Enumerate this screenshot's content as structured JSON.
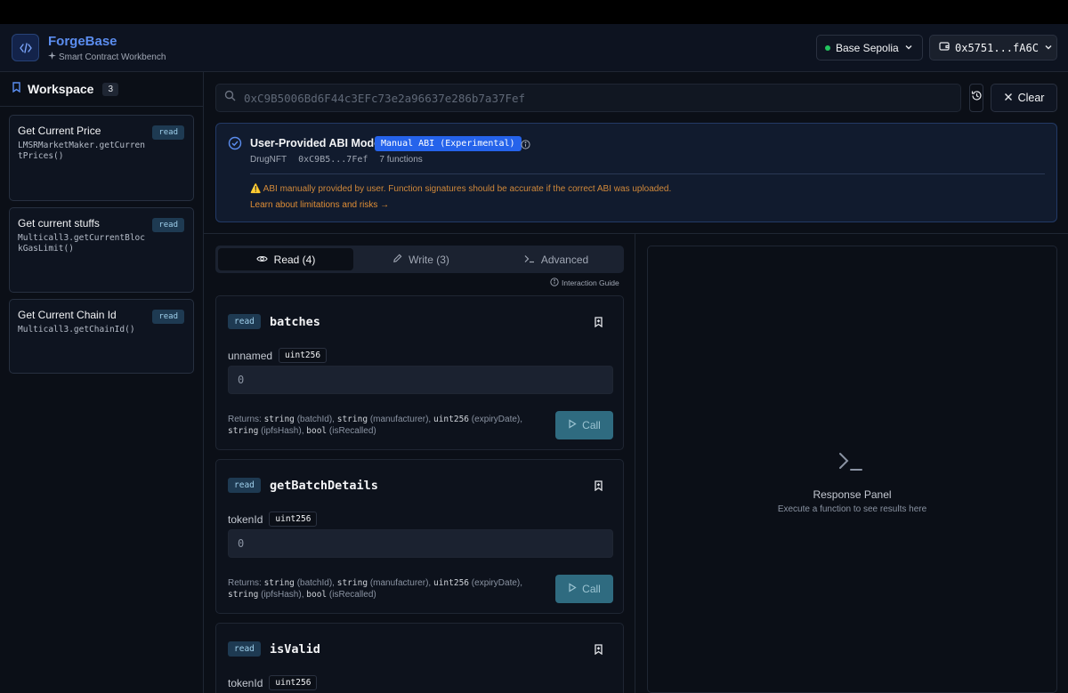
{
  "app": {
    "name": "ForgeBase",
    "subtitle": "Smart Contract Workbench"
  },
  "header": {
    "network_label": "Base Sepolia",
    "network_status_color": "#22c55e",
    "wallet_address": "0x5751...fA6C"
  },
  "sidebar": {
    "title": "Workspace",
    "count": "3",
    "items": [
      {
        "title": "Get Current Price",
        "fn": "LMSRMarketMaker.getCurrentPrices()",
        "badge": "read"
      },
      {
        "title": "Get current stuffs",
        "fn": "Multicall3.getCurrentBlockGasLimit()",
        "badge": "read"
      },
      {
        "title": "Get Current Chain Id",
        "fn": "Multicall3.getChainId()",
        "badge": "read"
      }
    ]
  },
  "search": {
    "value": "0xC9B5006Bd6F44c3EFc73e2a96637e286b7a37Fef",
    "clear_label": "Clear"
  },
  "abi": {
    "title": "User-Provided ABI Mode",
    "badge": "Manual ABI (Experimental)",
    "contract_name": "DrugNFT",
    "contract_address": "0xC9B5...7Fef",
    "function_count": "7 functions",
    "warning": "⚠️ ABI manually provided by user. Function signatures should be accurate if the correct ABI was uploaded.",
    "link": "Learn about limitations and risks →"
  },
  "tabs": [
    {
      "label": "Read (4)"
    },
    {
      "label": "Write (3)"
    },
    {
      "label": "Advanced"
    }
  ],
  "guide_label": "Interaction Guide",
  "functions": [
    {
      "badge": "read",
      "name": "batches",
      "param_name": "unnamed",
      "param_type": "uint256",
      "placeholder": "0",
      "returns": [
        {
          "type": "string",
          "name": "(batchId)"
        },
        {
          "type": "string",
          "name": "(manufacturer)"
        },
        {
          "type": "uint256",
          "name": "(expiryDate)"
        },
        {
          "type": "string",
          "name": "(ipfsHash)"
        },
        {
          "type": "bool",
          "name": "(isRecalled)"
        }
      ],
      "returns_label": "Returns:",
      "call_label": "Call"
    },
    {
      "badge": "read",
      "name": "getBatchDetails",
      "param_name": "tokenId",
      "param_type": "uint256",
      "placeholder": "0",
      "returns": [
        {
          "type": "string",
          "name": "(batchId)"
        },
        {
          "type": "string",
          "name": "(manufacturer)"
        },
        {
          "type": "uint256",
          "name": "(expiryDate)"
        },
        {
          "type": "string",
          "name": "(ipfsHash)"
        },
        {
          "type": "bool",
          "name": "(isRecalled)"
        }
      ],
      "returns_label": "Returns:",
      "call_label": "Call"
    },
    {
      "badge": "read",
      "name": "isValid",
      "param_name": "tokenId",
      "param_type": "uint256"
    }
  ],
  "response": {
    "title": "Response Panel",
    "subtitle": "Execute a function to see results here"
  }
}
